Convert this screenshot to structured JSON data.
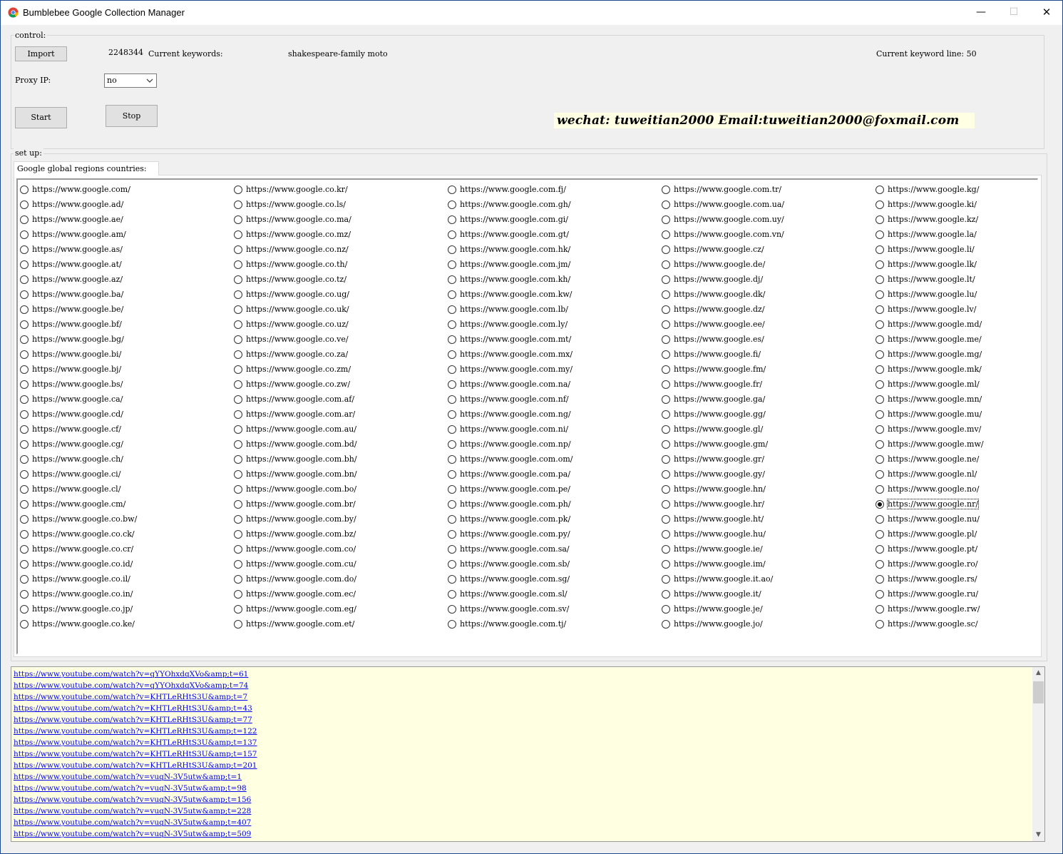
{
  "window": {
    "title": "Bumblebee Google Collection Manager",
    "min": "—",
    "max": "☐",
    "close": "✕"
  },
  "control": {
    "group_label": "control:",
    "import_label": "Import",
    "count": "2248344",
    "keywords_label": "Current keywords:",
    "keyword": "shakespeare-family moto",
    "line_label": "Current keyword line:",
    "line_value": "50",
    "proxy_label": "Proxy IP:",
    "proxy_value": "no",
    "start_label": "Start",
    "stop_label": "Stop",
    "banner": "wechat: tuweitian2000 Email:tuweitian2000@foxmail.com"
  },
  "setup": {
    "group_label": "set up:",
    "tab_label": "Google global regions countries:",
    "selected": "https://www.google.nr/",
    "columns": [
      [
        "https://www.google.com/",
        "https://www.google.ad/",
        "https://www.google.ae/",
        "https://www.google.am/",
        "https://www.google.as/",
        "https://www.google.at/",
        "https://www.google.az/",
        "https://www.google.ba/",
        "https://www.google.be/",
        "https://www.google.bf/",
        "https://www.google.bg/",
        "https://www.google.bi/",
        "https://www.google.bj/",
        "https://www.google.bs/",
        "https://www.google.ca/",
        "https://www.google.cd/",
        "https://www.google.cf/",
        "https://www.google.cg/",
        "https://www.google.ch/",
        "https://www.google.ci/",
        "https://www.google.cl/",
        "https://www.google.cm/",
        "https://www.google.co.bw/",
        "https://www.google.co.ck/",
        "https://www.google.co.cr/",
        "https://www.google.co.id/",
        "https://www.google.co.il/",
        "https://www.google.co.in/",
        "https://www.google.co.jp/",
        "https://www.google.co.ke/"
      ],
      [
        "https://www.google.co.kr/",
        "https://www.google.co.ls/",
        "https://www.google.co.ma/",
        "https://www.google.co.mz/",
        "https://www.google.co.nz/",
        "https://www.google.co.th/",
        "https://www.google.co.tz/",
        "https://www.google.co.ug/",
        "https://www.google.co.uk/",
        "https://www.google.co.uz/",
        "https://www.google.co.ve/",
        "https://www.google.co.za/",
        "https://www.google.co.zm/",
        "https://www.google.co.zw/",
        "https://www.google.com.af/",
        "https://www.google.com.ar/",
        "https://www.google.com.au/",
        "https://www.google.com.bd/",
        "https://www.google.com.bh/",
        "https://www.google.com.bn/",
        "https://www.google.com.bo/",
        "https://www.google.com.br/",
        "https://www.google.com.by/",
        "https://www.google.com.bz/",
        "https://www.google.com.co/",
        "https://www.google.com.cu/",
        "https://www.google.com.do/",
        "https://www.google.com.ec/",
        "https://www.google.com.eg/",
        "https://www.google.com.et/"
      ],
      [
        "https://www.google.com.fj/",
        "https://www.google.com.gh/",
        "https://www.google.com.gi/",
        "https://www.google.com.gt/",
        "https://www.google.com.hk/",
        "https://www.google.com.jm/",
        "https://www.google.com.kh/",
        "https://www.google.com.kw/",
        "https://www.google.com.lb/",
        "https://www.google.com.ly/",
        "https://www.google.com.mt/",
        "https://www.google.com.mx/",
        "https://www.google.com.my/",
        "https://www.google.com.na/",
        "https://www.google.com.nf/",
        "https://www.google.com.ng/",
        "https://www.google.com.ni/",
        "https://www.google.com.np/",
        "https://www.google.com.om/",
        "https://www.google.com.pa/",
        "https://www.google.com.pe/",
        "https://www.google.com.ph/",
        "https://www.google.com.pk/",
        "https://www.google.com.py/",
        "https://www.google.com.sa/",
        "https://www.google.com.sb/",
        "https://www.google.com.sg/",
        "https://www.google.com.sl/",
        "https://www.google.com.sv/",
        "https://www.google.com.tj/"
      ],
      [
        "https://www.google.com.tr/",
        "https://www.google.com.ua/",
        "https://www.google.com.uy/",
        "https://www.google.com.vn/",
        "https://www.google.cz/",
        "https://www.google.de/",
        "https://www.google.dj/",
        "https://www.google.dk/",
        "https://www.google.dz/",
        "https://www.google.ee/",
        "https://www.google.es/",
        "https://www.google.fi/",
        "https://www.google.fm/",
        "https://www.google.fr/",
        "https://www.google.ga/",
        "https://www.google.gg/",
        "https://www.google.gl/",
        "https://www.google.gm/",
        "https://www.google.gr/",
        "https://www.google.gy/",
        "https://www.google.hn/",
        "https://www.google.hr/",
        "https://www.google.ht/",
        "https://www.google.hu/",
        "https://www.google.ie/",
        "https://www.google.im/",
        "https://www.google.it.ao/",
        "https://www.google.it/",
        "https://www.google.je/",
        "https://www.google.jo/"
      ],
      [
        "https://www.google.kg/",
        "https://www.google.ki/",
        "https://www.google.kz/",
        "https://www.google.la/",
        "https://www.google.li/",
        "https://www.google.lk/",
        "https://www.google.lt/",
        "https://www.google.lu/",
        "https://www.google.lv/",
        "https://www.google.md/",
        "https://www.google.me/",
        "https://www.google.mg/",
        "https://www.google.mk/",
        "https://www.google.ml/",
        "https://www.google.mn/",
        "https://www.google.mu/",
        "https://www.google.mv/",
        "https://www.google.mw/",
        "https://www.google.ne/",
        "https://www.google.nl/",
        "https://www.google.no/",
        "https://www.google.nr/",
        "https://www.google.nu/",
        "https://www.google.pl/",
        "https://www.google.pt/",
        "https://www.google.ro/",
        "https://www.google.rs/",
        "https://www.google.ru/",
        "https://www.google.rw/",
        "https://www.google.sc/"
      ]
    ]
  },
  "log": {
    "links": [
      "https://www.youtube.com/watch?v=qYYOhxdqXVo&amp;t=61",
      "https://www.youtube.com/watch?v=qYYOhxdqXVo&amp;t=74",
      "https://www.youtube.com/watch?v=KHTLeRHtS3U&amp;t=7",
      "https://www.youtube.com/watch?v=KHTLeRHtS3U&amp;t=43",
      "https://www.youtube.com/watch?v=KHTLeRHtS3U&amp;t=77",
      "https://www.youtube.com/watch?v=KHTLeRHtS3U&amp;t=122",
      "https://www.youtube.com/watch?v=KHTLeRHtS3U&amp;t=137",
      "https://www.youtube.com/watch?v=KHTLeRHtS3U&amp;t=157",
      "https://www.youtube.com/watch?v=KHTLeRHtS3U&amp;t=201",
      "https://www.youtube.com/watch?v=vuqN-3V5utw&amp;t=1",
      "https://www.youtube.com/watch?v=vuqN-3V5utw&amp;t=98",
      "https://www.youtube.com/watch?v=vuqN-3V5utw&amp;t=156",
      "https://www.youtube.com/watch?v=vuqN-3V5utw&amp;t=228",
      "https://www.youtube.com/watch?v=vuqN-3V5utw&amp;t=407",
      "https://www.youtube.com/watch?v=vuqN-3V5utw&amp;t=509"
    ]
  },
  "colors": {
    "window_border": "#1e4a8c",
    "link": "#0000ee",
    "log_bg": "#ffffe1",
    "banner_bg": "#ffffe4"
  },
  "icons": [
    "chrome-icon",
    "minimize-icon",
    "maximize-icon",
    "close-icon",
    "chevron-down-icon",
    "scroll-up-icon",
    "scroll-down-icon"
  ]
}
